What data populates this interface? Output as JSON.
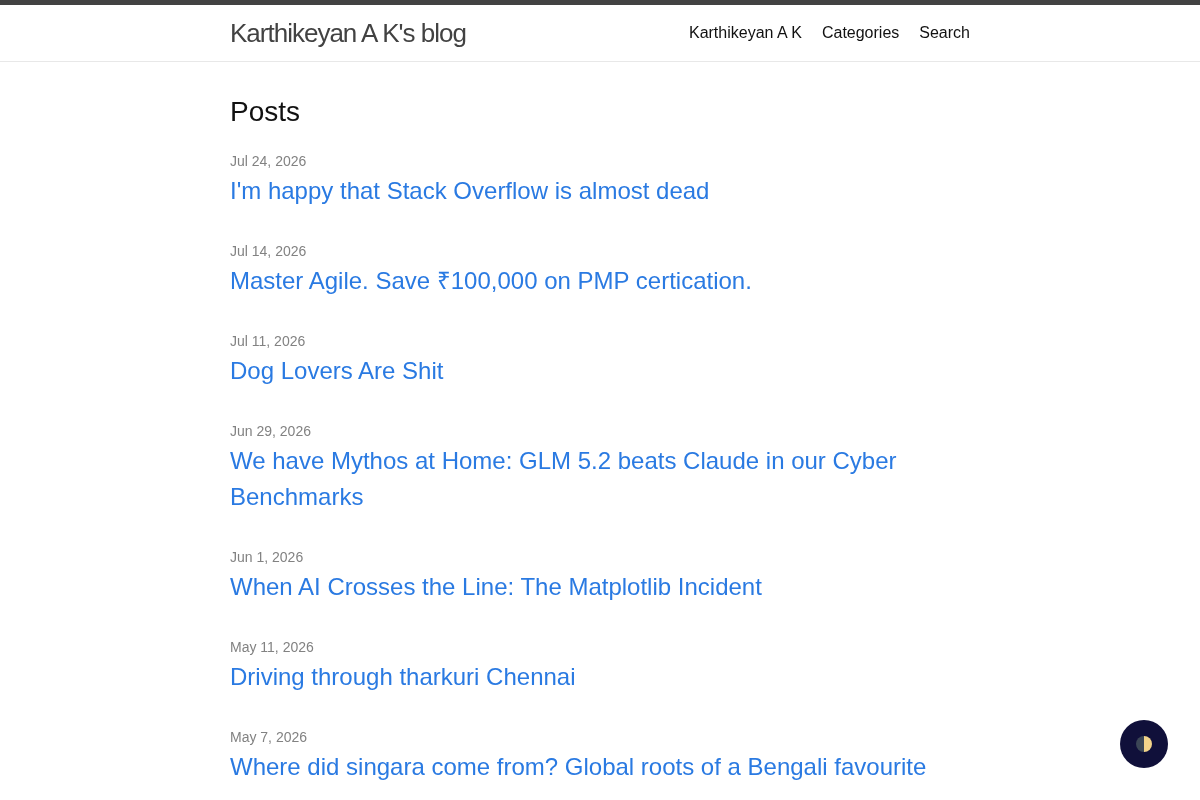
{
  "site_title": "Karthikeyan A K's blog",
  "nav": [
    "Karthikeyan A K",
    "Categories",
    "Search"
  ],
  "heading": "Posts",
  "posts": [
    {
      "date": "Jul 24, 2026",
      "title": "I'm happy that Stack Overflow is almost dead"
    },
    {
      "date": "Jul 14, 2026",
      "title": "Master Agile. Save ₹100,000 on PMP certication."
    },
    {
      "date": "Jul 11, 2026",
      "title": "Dog Lovers Are Shit"
    },
    {
      "date": "Jun 29, 2026",
      "title": "We have Mythos at Home: GLM 5.2 beats Claude in our Cyber Benchmarks"
    },
    {
      "date": "Jun 1, 2026",
      "title": "When AI Crosses the Line: The Matplotlib Incident"
    },
    {
      "date": "May 11, 2026",
      "title": "Driving through tharkuri Chennai"
    },
    {
      "date": "May 7, 2026",
      "title": "Where did singara come from? Global roots of a Bengali favourite"
    }
  ]
}
